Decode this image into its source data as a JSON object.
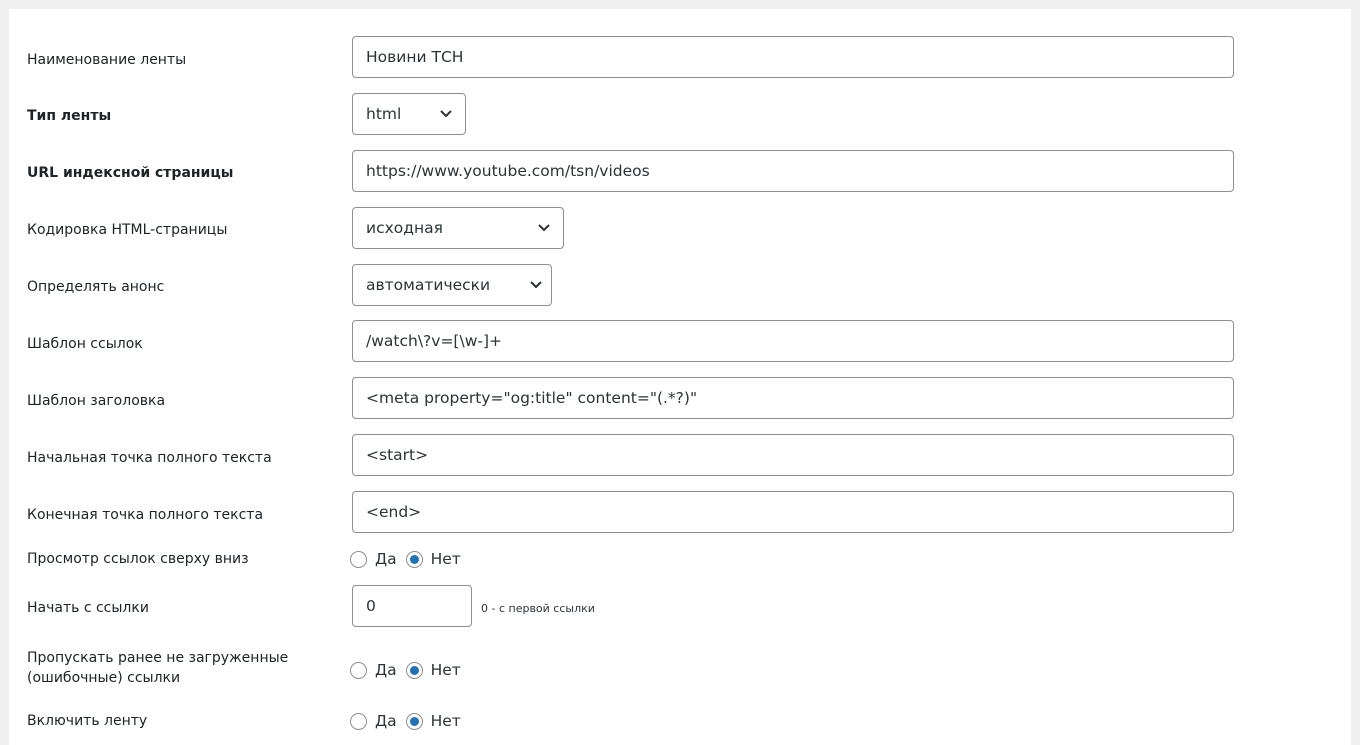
{
  "fields": {
    "feed_name": {
      "label": "Наименование ленты",
      "value": "Новини ТСН"
    },
    "feed_type": {
      "label": "Тип ленты",
      "value": "html"
    },
    "index_url": {
      "label": "URL индексной страницы",
      "value": "https://www.youtube.com/tsn/videos"
    },
    "encoding": {
      "label": "Кодировка HTML-страницы",
      "value": "исходная"
    },
    "announce": {
      "label": "Определять анонс",
      "value": "автоматически"
    },
    "link_pattern": {
      "label": "Шаблон ссылок",
      "value": "/watch\\?v=[\\w-]+"
    },
    "title_pattern": {
      "label": "Шаблон заголовка",
      "value": "<meta property=\"og:title\" content=\"(.*?)\""
    },
    "fulltext_start": {
      "label": "Начальная точка полного текста",
      "value": "<start>"
    },
    "fulltext_end": {
      "label": "Конечная точка полного текста",
      "value": "<end>"
    },
    "top_down": {
      "label": "Просмотр ссылок сверху вниз",
      "yes": "Да",
      "no": "Нет",
      "selected": "no"
    },
    "start_link": {
      "label": "Начать с ссылки",
      "value": "0",
      "hint": "0 - с первой ссылки"
    },
    "skip_failed": {
      "label": "Пропускать ранее не загруженные (ошибочные) ссылки",
      "yes": "Да",
      "no": "Нет",
      "selected": "no"
    },
    "enable_feed": {
      "label": "Включить ленту",
      "yes": "Да",
      "no": "Нет",
      "selected": "no"
    }
  },
  "colors": {
    "radio_checked": "#2271b1",
    "border": "#8c8f94",
    "background": "#f0f0f1",
    "panel": "#ffffff"
  }
}
